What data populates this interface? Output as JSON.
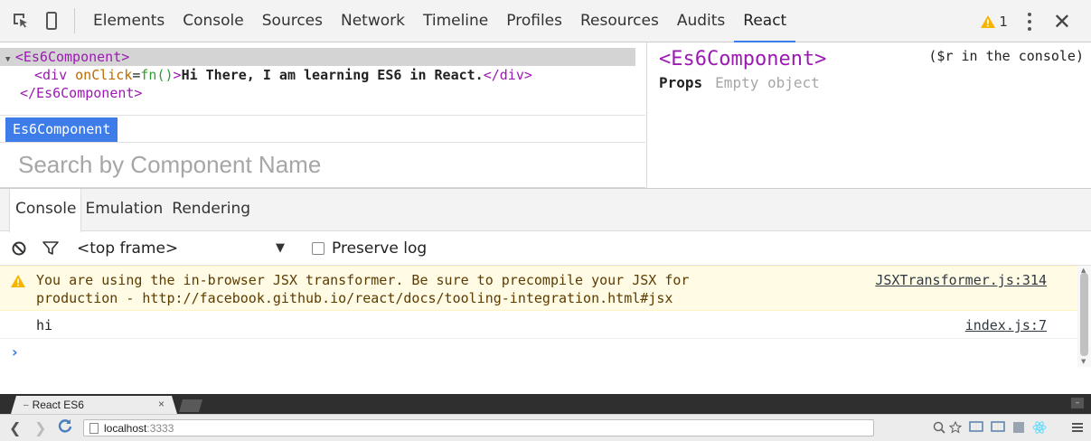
{
  "devtools": {
    "tabs": [
      {
        "label": "Elements",
        "active": false
      },
      {
        "label": "Console",
        "active": false
      },
      {
        "label": "Sources",
        "active": false
      },
      {
        "label": "Network",
        "active": false
      },
      {
        "label": "Timeline",
        "active": false
      },
      {
        "label": "Profiles",
        "active": false
      },
      {
        "label": "Resources",
        "active": false
      },
      {
        "label": "Audits",
        "active": false
      },
      {
        "label": "React",
        "active": true
      }
    ],
    "warning_count": "1",
    "accent_color": "#3e7de9",
    "warning_color": "#f4b400"
  },
  "react_panel": {
    "tree": {
      "open_tag": "<Es6Component>",
      "child_open": "<div ",
      "child_attr": "onClick",
      "child_eq": "=",
      "child_attr_value": "fn()",
      "child_gt": ">",
      "child_text": "Hi There, I am learning ES6 in React.",
      "child_close": "</div>",
      "close_tag": "</Es6Component>"
    },
    "breadcrumb": "Es6Component",
    "search_placeholder": "Search by Component Name",
    "details": {
      "title": "<Es6Component>",
      "console_hint": "($r in the console)",
      "props_label": "Props",
      "props_value": "Empty object"
    }
  },
  "drawer": {
    "tabs": [
      {
        "label": "Console",
        "active": true
      },
      {
        "label": "Emulation",
        "active": false
      },
      {
        "label": "Rendering",
        "active": false
      }
    ],
    "frame_select": "<top frame>",
    "preserve_log_label": "Preserve log",
    "preserve_log_checked": false
  },
  "console": {
    "messages": [
      {
        "level": "warning",
        "line1": "You are using the in-browser JSX transformer. Be sure to precompile your JSX for",
        "line2": "production - http://facebook.github.io/react/docs/tooling-integration.html#jsx",
        "source": "JSXTransformer.js:314"
      },
      {
        "level": "log",
        "text": "hi",
        "source": "index.js:7"
      }
    ],
    "prompt": "›"
  },
  "browser": {
    "tab_title": "React ES6",
    "tab_close": "×",
    "url_host": "localhost",
    "url_port": ":3333",
    "minimize": "–"
  },
  "icons": {
    "inspect": "inspect-icon",
    "device": "device-mode-icon",
    "warning": "warning-triangle-icon",
    "more": "more-vertical-icon",
    "close": "close-icon",
    "clear": "clear-console-icon",
    "filter": "filter-icon",
    "zoom": "zoom-icon",
    "bookmark": "star-icon",
    "react_ext": "react-icon",
    "menu": "hamburger-menu-icon"
  }
}
